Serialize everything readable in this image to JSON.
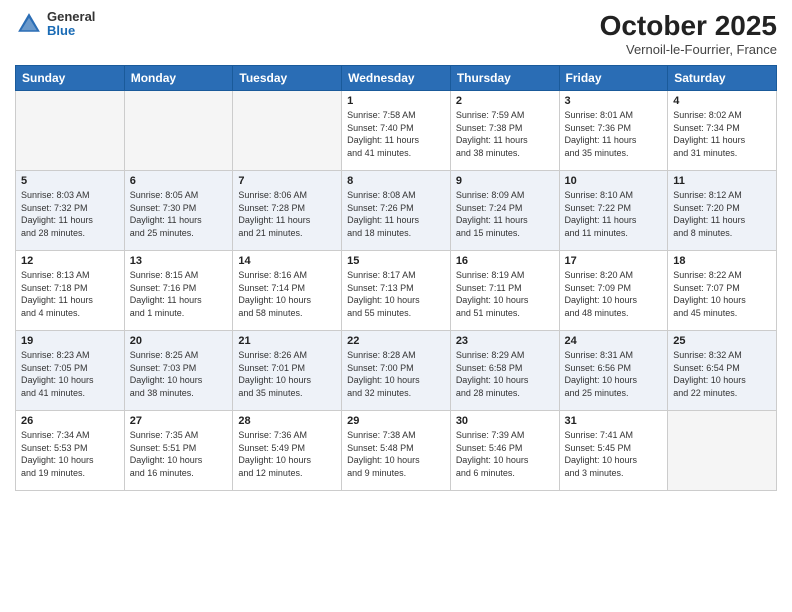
{
  "header": {
    "logo": {
      "general": "General",
      "blue": "Blue"
    },
    "title": "October 2025",
    "location": "Vernoil-le-Fourrier, France"
  },
  "weekdays": [
    "Sunday",
    "Monday",
    "Tuesday",
    "Wednesday",
    "Thursday",
    "Friday",
    "Saturday"
  ],
  "weeks": [
    [
      {
        "day": "",
        "info": ""
      },
      {
        "day": "",
        "info": ""
      },
      {
        "day": "",
        "info": ""
      },
      {
        "day": "1",
        "info": "Sunrise: 7:58 AM\nSunset: 7:40 PM\nDaylight: 11 hours\nand 41 minutes."
      },
      {
        "day": "2",
        "info": "Sunrise: 7:59 AM\nSunset: 7:38 PM\nDaylight: 11 hours\nand 38 minutes."
      },
      {
        "day": "3",
        "info": "Sunrise: 8:01 AM\nSunset: 7:36 PM\nDaylight: 11 hours\nand 35 minutes."
      },
      {
        "day": "4",
        "info": "Sunrise: 8:02 AM\nSunset: 7:34 PM\nDaylight: 11 hours\nand 31 minutes."
      }
    ],
    [
      {
        "day": "5",
        "info": "Sunrise: 8:03 AM\nSunset: 7:32 PM\nDaylight: 11 hours\nand 28 minutes."
      },
      {
        "day": "6",
        "info": "Sunrise: 8:05 AM\nSunset: 7:30 PM\nDaylight: 11 hours\nand 25 minutes."
      },
      {
        "day": "7",
        "info": "Sunrise: 8:06 AM\nSunset: 7:28 PM\nDaylight: 11 hours\nand 21 minutes."
      },
      {
        "day": "8",
        "info": "Sunrise: 8:08 AM\nSunset: 7:26 PM\nDaylight: 11 hours\nand 18 minutes."
      },
      {
        "day": "9",
        "info": "Sunrise: 8:09 AM\nSunset: 7:24 PM\nDaylight: 11 hours\nand 15 minutes."
      },
      {
        "day": "10",
        "info": "Sunrise: 8:10 AM\nSunset: 7:22 PM\nDaylight: 11 hours\nand 11 minutes."
      },
      {
        "day": "11",
        "info": "Sunrise: 8:12 AM\nSunset: 7:20 PM\nDaylight: 11 hours\nand 8 minutes."
      }
    ],
    [
      {
        "day": "12",
        "info": "Sunrise: 8:13 AM\nSunset: 7:18 PM\nDaylight: 11 hours\nand 4 minutes."
      },
      {
        "day": "13",
        "info": "Sunrise: 8:15 AM\nSunset: 7:16 PM\nDaylight: 11 hours\nand 1 minute."
      },
      {
        "day": "14",
        "info": "Sunrise: 8:16 AM\nSunset: 7:14 PM\nDaylight: 10 hours\nand 58 minutes."
      },
      {
        "day": "15",
        "info": "Sunrise: 8:17 AM\nSunset: 7:13 PM\nDaylight: 10 hours\nand 55 minutes."
      },
      {
        "day": "16",
        "info": "Sunrise: 8:19 AM\nSunset: 7:11 PM\nDaylight: 10 hours\nand 51 minutes."
      },
      {
        "day": "17",
        "info": "Sunrise: 8:20 AM\nSunset: 7:09 PM\nDaylight: 10 hours\nand 48 minutes."
      },
      {
        "day": "18",
        "info": "Sunrise: 8:22 AM\nSunset: 7:07 PM\nDaylight: 10 hours\nand 45 minutes."
      }
    ],
    [
      {
        "day": "19",
        "info": "Sunrise: 8:23 AM\nSunset: 7:05 PM\nDaylight: 10 hours\nand 41 minutes."
      },
      {
        "day": "20",
        "info": "Sunrise: 8:25 AM\nSunset: 7:03 PM\nDaylight: 10 hours\nand 38 minutes."
      },
      {
        "day": "21",
        "info": "Sunrise: 8:26 AM\nSunset: 7:01 PM\nDaylight: 10 hours\nand 35 minutes."
      },
      {
        "day": "22",
        "info": "Sunrise: 8:28 AM\nSunset: 7:00 PM\nDaylight: 10 hours\nand 32 minutes."
      },
      {
        "day": "23",
        "info": "Sunrise: 8:29 AM\nSunset: 6:58 PM\nDaylight: 10 hours\nand 28 minutes."
      },
      {
        "day": "24",
        "info": "Sunrise: 8:31 AM\nSunset: 6:56 PM\nDaylight: 10 hours\nand 25 minutes."
      },
      {
        "day": "25",
        "info": "Sunrise: 8:32 AM\nSunset: 6:54 PM\nDaylight: 10 hours\nand 22 minutes."
      }
    ],
    [
      {
        "day": "26",
        "info": "Sunrise: 7:34 AM\nSunset: 5:53 PM\nDaylight: 10 hours\nand 19 minutes."
      },
      {
        "day": "27",
        "info": "Sunrise: 7:35 AM\nSunset: 5:51 PM\nDaylight: 10 hours\nand 16 minutes."
      },
      {
        "day": "28",
        "info": "Sunrise: 7:36 AM\nSunset: 5:49 PM\nDaylight: 10 hours\nand 12 minutes."
      },
      {
        "day": "29",
        "info": "Sunrise: 7:38 AM\nSunset: 5:48 PM\nDaylight: 10 hours\nand 9 minutes."
      },
      {
        "day": "30",
        "info": "Sunrise: 7:39 AM\nSunset: 5:46 PM\nDaylight: 10 hours\nand 6 minutes."
      },
      {
        "day": "31",
        "info": "Sunrise: 7:41 AM\nSunset: 5:45 PM\nDaylight: 10 hours\nand 3 minutes."
      },
      {
        "day": "",
        "info": ""
      }
    ]
  ]
}
